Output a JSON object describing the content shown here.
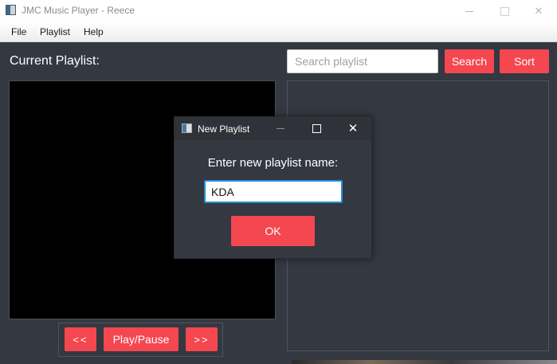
{
  "window": {
    "title": "JMC Music Player - Reece"
  },
  "menu": {
    "items": [
      "File",
      "Playlist",
      "Help"
    ]
  },
  "main": {
    "current_playlist_label": "Current Playlist:",
    "search_placeholder": "Search playlist",
    "search_value": "",
    "search_button": "Search",
    "sort_button": "Sort"
  },
  "controls": {
    "prev_label": "<<",
    "play_pause_label": "Play/Pause",
    "next_label": ">>"
  },
  "dialog": {
    "title": "New Playlist",
    "prompt": "Enter new playlist name:",
    "input_value": "KDA",
    "ok_label": "OK"
  },
  "colors": {
    "background": "#343841",
    "accent": "#f4474f",
    "video_background": "#000000",
    "focus_border": "#1f8fd6"
  },
  "icons": [
    "app-icon",
    "minimize-icon",
    "maximize-icon",
    "close-icon"
  ]
}
